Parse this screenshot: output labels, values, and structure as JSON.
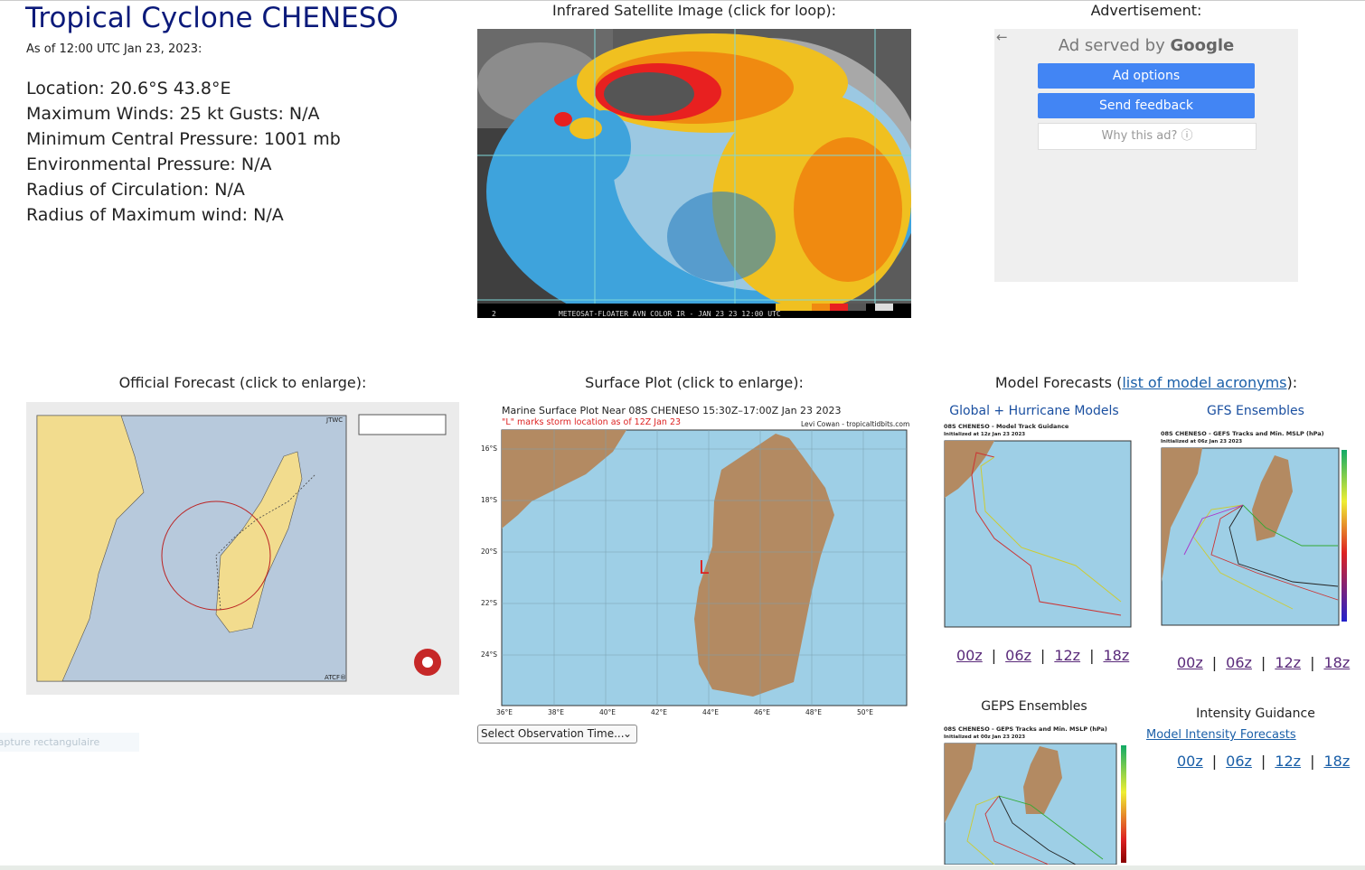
{
  "header": {
    "title": "Tropical Cyclone CHENESO",
    "as_of": "As of 12:00 UTC Jan 23, 2023:"
  },
  "info": {
    "location": "Location: 20.6°S 43.8°E",
    "winds": "Maximum Winds: 25 kt  Gusts: N/A",
    "pressure": "Minimum Central Pressure: 1001 mb",
    "env_pressure": "Environmental Pressure: N/A",
    "radius_circ": "Radius of Circulation: N/A",
    "radius_max": "Radius of Maximum wind: N/A"
  },
  "satellite": {
    "caption": "Infrared Satellite Image (click for loop):",
    "bar_text": "METEOSAT-FLOATER AVN COLOR IR - JAN 23 23 12:00 UTC",
    "bar_num": "2"
  },
  "ad": {
    "caption": "Advertisement:",
    "served_by": "Ad served by",
    "google": "Google",
    "options": "Ad options",
    "feedback": "Send feedback",
    "why": "Why this ad? ⓘ"
  },
  "official": {
    "caption": "Official Forecast (click to enlarge):",
    "jtwc": "JTWC",
    "atcf": "ATCF®"
  },
  "surface": {
    "caption": "Surface Plot (click to enlarge):",
    "plot_title": "Marine Surface Plot Near 08S CHENESO 15:30Z–17:00Z Jan 23 2023",
    "plot_note": "\"L\" marks storm location as of 12Z Jan 23",
    "credit": "Levi Cowan - tropicaltidbits.com",
    "lat_labels": [
      "16°S",
      "18°S",
      "20°S",
      "22°S",
      "24°S"
    ],
    "lon_labels": [
      "36°E",
      "38°E",
      "40°E",
      "42°E",
      "44°E",
      "46°E",
      "48°E",
      "50°E"
    ],
    "select_label": "Select Observation Time..."
  },
  "models": {
    "caption_prefix": "Model Forecasts (",
    "caption_link": "list of model acronyms",
    "caption_suffix": "):",
    "global_title": "Global + Hurricane Models",
    "global_plot_title": "08S CHENESO - Model Track Guidance",
    "global_plot_sub": "Initialized at 12z Jan 23 2023",
    "gfs_title": "GFS Ensembles",
    "gfs_plot_title": "08S CHENESO - GEFS Tracks and Min. MSLP (hPa)",
    "gfs_plot_sub": "Initialized at 06z Jan 23 2023",
    "geps_title": "GEPS Ensembles",
    "geps_plot_title": "08S CHENESO - GEPS Tracks and Min. MSLP (hPa)",
    "geps_plot_sub": "Initialized at 00z Jan 23 2023",
    "intensity_title": "Intensity Guidance",
    "intensity_link": "Model Intensity Forecasts",
    "runs": [
      "00z",
      "06z",
      "12z",
      "18z"
    ]
  },
  "capture_text": "Capture rectangulaire"
}
